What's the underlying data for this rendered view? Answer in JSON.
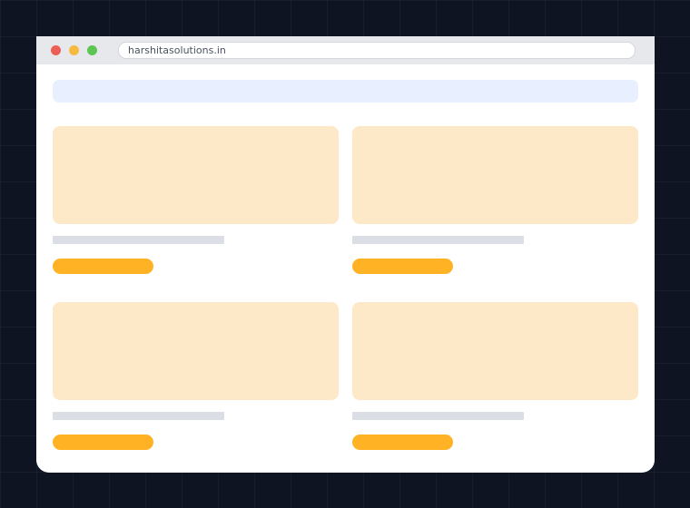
{
  "window": {
    "url": "harshitasolutions.in",
    "traffic_lights": {
      "close_color": "#ec5f57",
      "minimize_color": "#f7b93f",
      "maximize_color": "#5cc652"
    }
  },
  "colors": {
    "background": "#0e1422",
    "search_bar": "#e8efff",
    "card_image": "#fde8c8",
    "card_title_placeholder": "#dcdee6",
    "card_button": "#ffb224"
  },
  "cards": [
    {
      "image_icon": "image-placeholder"
    },
    {
      "image_icon": "image-placeholder"
    },
    {
      "image_icon": "image-placeholder"
    },
    {
      "image_icon": "image-placeholder"
    }
  ]
}
